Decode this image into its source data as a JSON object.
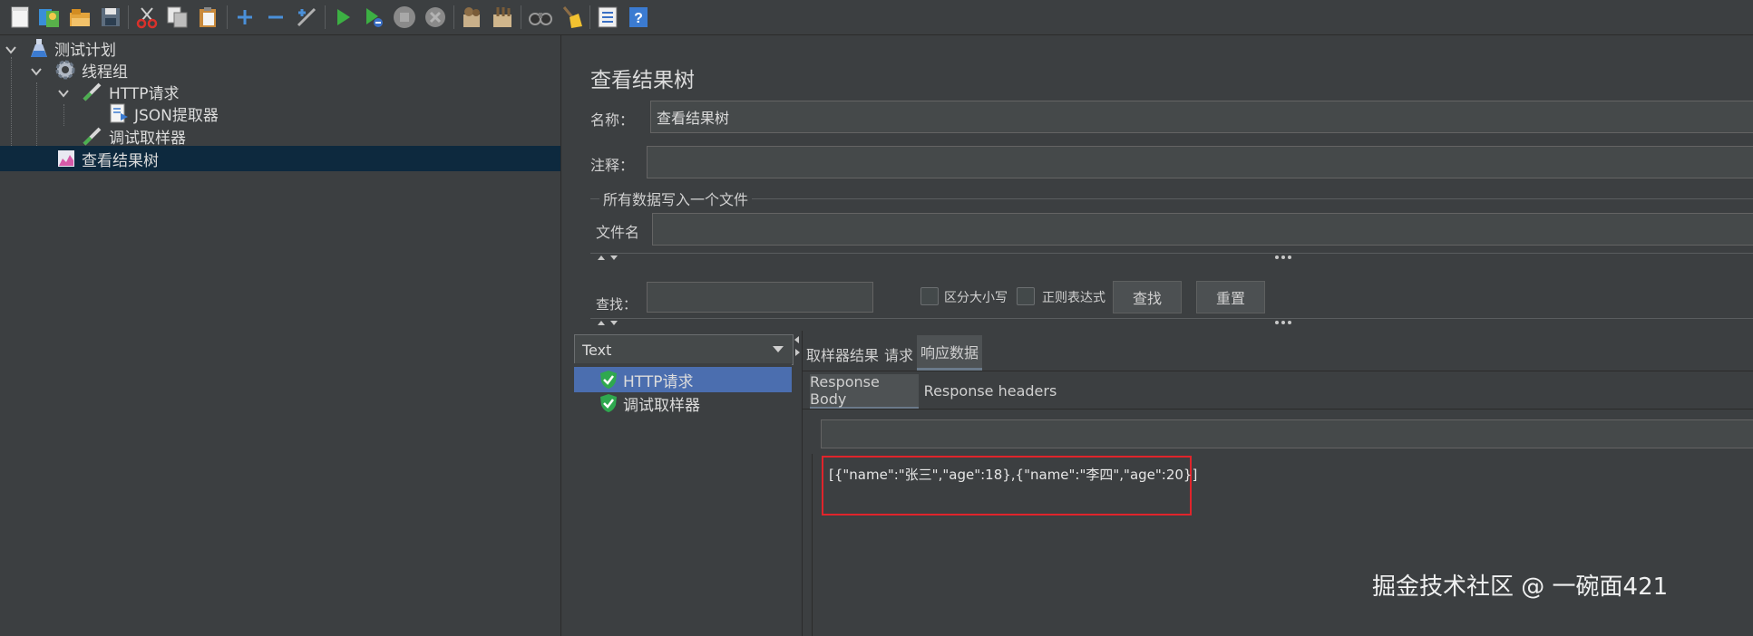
{
  "toolbar": {
    "icons": [
      "new-icon",
      "templates-icon",
      "open-icon",
      "save-icon",
      "cut-icon",
      "copy-icon",
      "paste-icon",
      "expand-icon",
      "collapse-icon",
      "toggle-icon",
      "start-icon",
      "start-no-pause-icon",
      "stop-icon",
      "shutdown-icon",
      "clear-icon",
      "clear-all-icon",
      "search-icon",
      "reset-search-icon",
      "function-helper-icon",
      "help-icon"
    ]
  },
  "tree": {
    "items": [
      {
        "label": "测试计划",
        "icon": "test-plan-icon"
      },
      {
        "label": "线程组",
        "icon": "thread-group-gear-icon"
      },
      {
        "label": "HTTP请求",
        "icon": "sampler-pipette-icon"
      },
      {
        "label": "JSON提取器",
        "icon": "extractor-document-icon"
      },
      {
        "label": "调试取样器",
        "icon": "sampler-pipette-icon"
      },
      {
        "label": "查看结果树",
        "icon": "listener-chart-icon"
      }
    ]
  },
  "panel": {
    "title": "查看结果树",
    "name_label": "名称：",
    "name_value": "查看结果树",
    "comment_label": "注释：",
    "comment_value": "",
    "file_section": "所有数据写入一个文件",
    "filename_label": "文件名",
    "filename_value": ""
  },
  "search": {
    "label": "查找：",
    "value": "",
    "case_sensitive": "区分大小写",
    "regex": "正则表达式",
    "find_button": "查找",
    "reset_button": "重置"
  },
  "renderer": {
    "selected": "Text"
  },
  "results": {
    "items": [
      {
        "label": "HTTP请求",
        "status": "success"
      },
      {
        "label": "调试取样器",
        "status": "success"
      }
    ]
  },
  "tabs": {
    "main": [
      "取样器结果",
      "请求",
      "响应数据"
    ],
    "active_main": "响应数据",
    "sub": [
      "Response Body",
      "Response headers"
    ],
    "active_sub": "Response Body"
  },
  "response": {
    "body": "[{\"name\":\"张三\",\"age\":18},{\"name\":\"李四\",\"age\":20}]",
    "highlight_color": "#e0242b"
  },
  "watermark": "掘金技术社区 @ 一碗面421"
}
